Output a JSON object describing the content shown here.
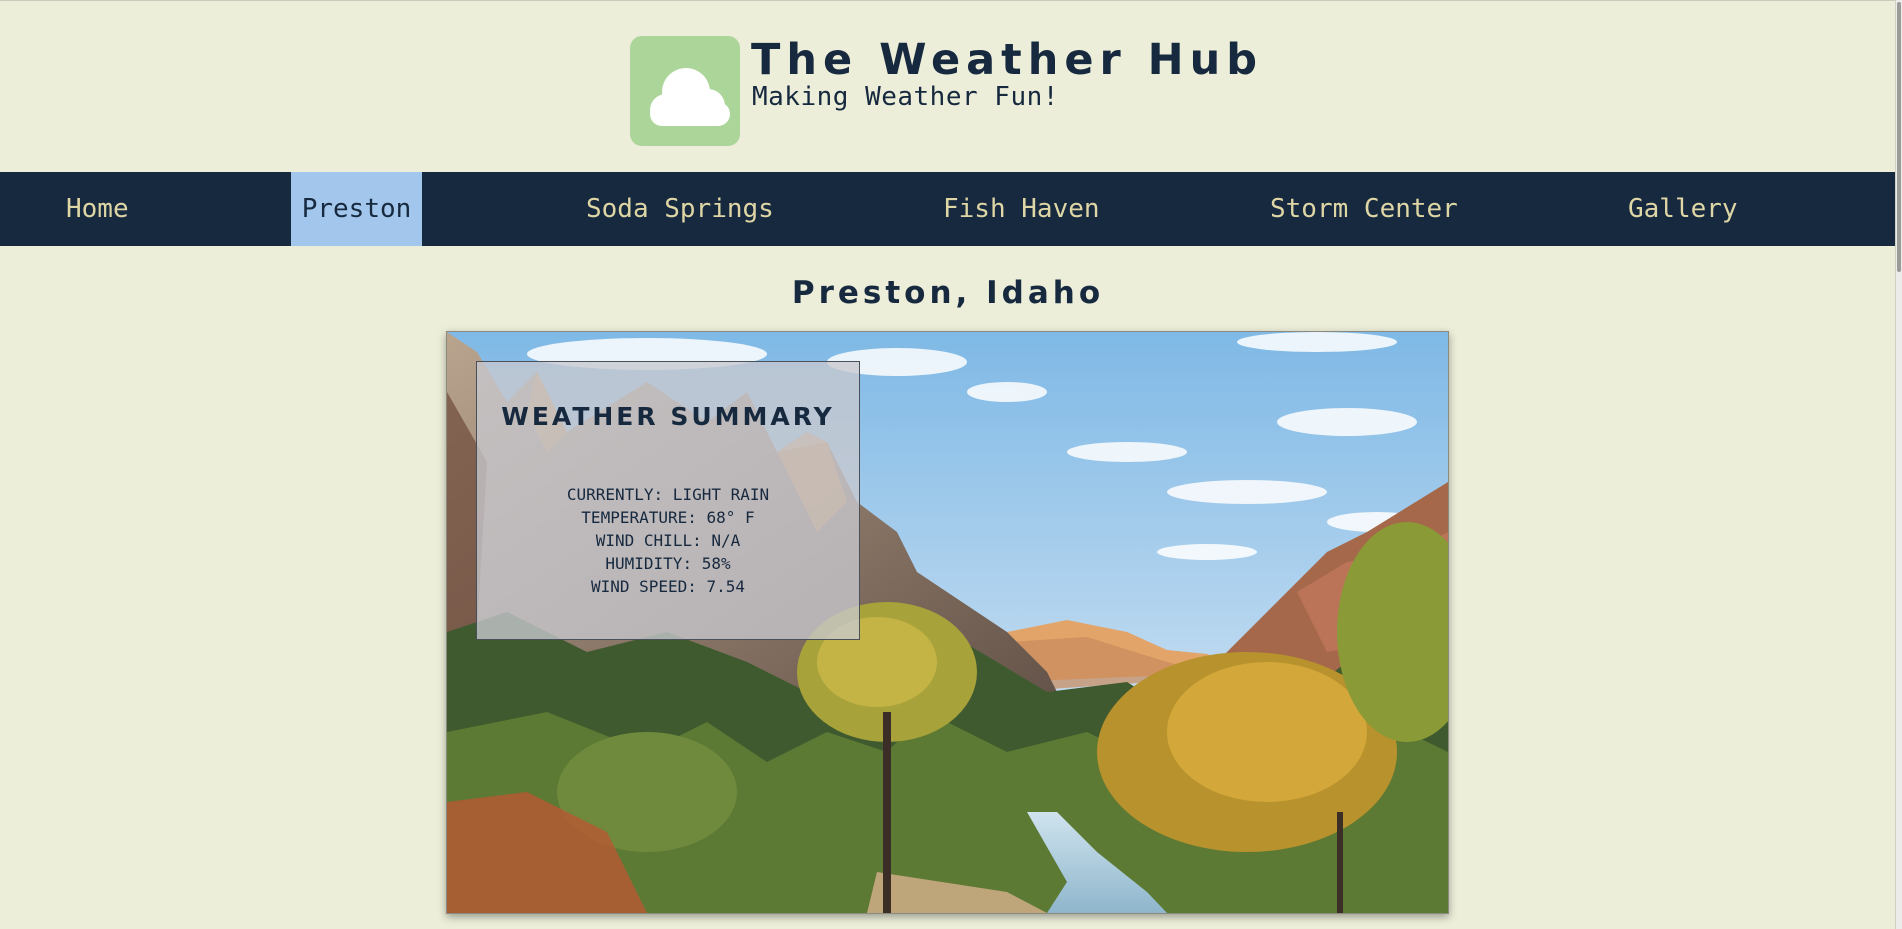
{
  "header": {
    "logo_icon": "cloud-icon",
    "title": "The Weather Hub",
    "subtitle": "Making Weather Fun!"
  },
  "nav": {
    "items": [
      {
        "label": "Home",
        "active": false
      },
      {
        "label": "Preston",
        "active": true
      },
      {
        "label": "Soda Springs",
        "active": false
      },
      {
        "label": "Fish Haven",
        "active": false
      },
      {
        "label": "Storm Center",
        "active": false
      },
      {
        "label": "Gallery",
        "active": false
      }
    ]
  },
  "page": {
    "heading": "Preston, Idaho"
  },
  "summary": {
    "title": "WEATHER SUMMARY",
    "currently": "CURRENTLY: LIGHT RAIN",
    "temperature": "TEMPERATURE: 68° F",
    "wind_chill": "WIND CHILL: N/A",
    "humidity": "HUMIDITY: 58%",
    "wind_speed": "WIND SPEED: 7.54"
  },
  "colors": {
    "background": "#eceed9",
    "navy": "#16293f",
    "nav_text": "#dfd6a6",
    "nav_active": "#a3c6ec",
    "logo_green": "#abd599"
  }
}
